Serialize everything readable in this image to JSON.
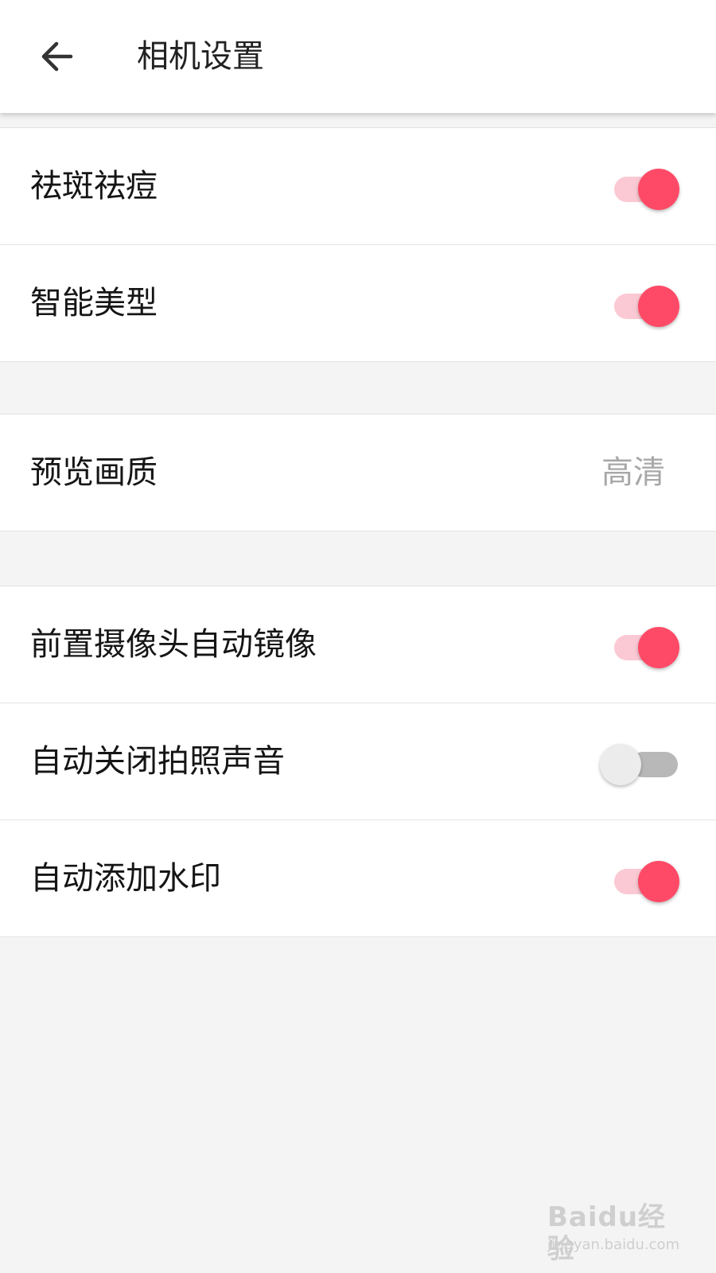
{
  "header": {
    "back_icon": "arrow-left-icon",
    "title": "相机设置"
  },
  "colors": {
    "accent": "#ff4a67",
    "switch_track_on": "#fbc9d3",
    "switch_off": "#b8b8b8",
    "page_background": "#f4f4f4"
  },
  "groups": [
    {
      "items": [
        {
          "label": "祛斑祛痘",
          "control": "switch",
          "checked": true
        },
        {
          "label": "智能美型",
          "control": "switch",
          "checked": true
        }
      ]
    },
    {
      "items": [
        {
          "label": "预览画质",
          "control": "value",
          "value": "高清"
        }
      ]
    },
    {
      "items": [
        {
          "label": "前置摄像头自动镜像",
          "control": "switch",
          "checked": true
        },
        {
          "label": "自动关闭拍照声音",
          "control": "switch",
          "checked": false
        },
        {
          "label": "自动添加水印",
          "control": "switch",
          "checked": true
        }
      ]
    }
  ],
  "watermark": {
    "main": "Baidu经验",
    "sub": "jingyan.baidu.com"
  }
}
